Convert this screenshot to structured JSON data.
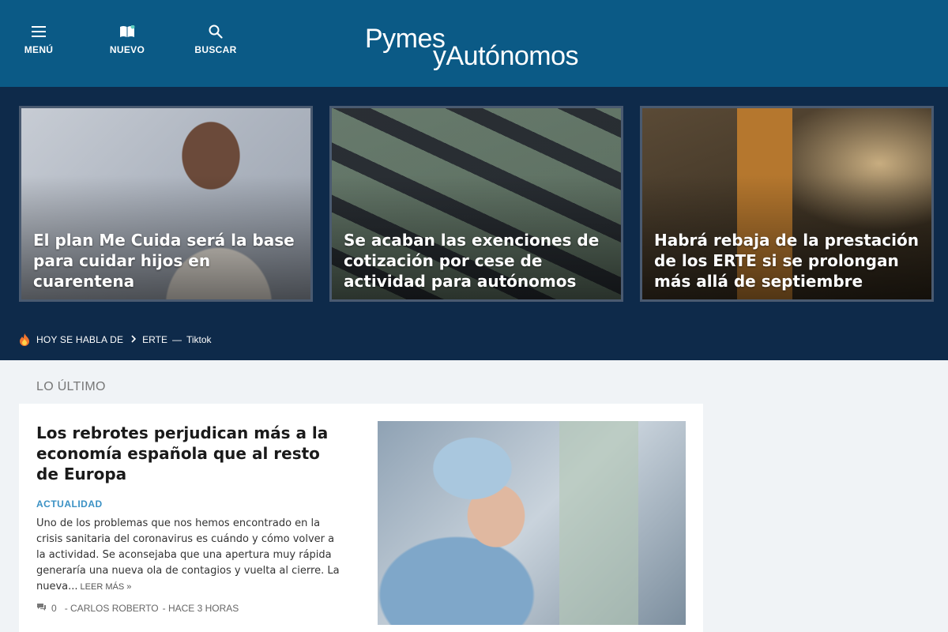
{
  "header": {
    "nav": {
      "menu_label": "MENÚ",
      "nuevo_label": "NUEVO",
      "buscar_label": "BUSCAR"
    },
    "logo": {
      "line1": "Pymes",
      "line2": "yAutónomos"
    },
    "colors": {
      "header_bg": "#0b5a86",
      "hero_bg": "#0e2a4a",
      "accent": "#3a91c4"
    }
  },
  "hero": {
    "cards": [
      {
        "title": "El plan Me Cuida será la base para cuidar hijos en cuarentena"
      },
      {
        "title": "Se acaban las exenciones de cotización por cese de actividad para autónomos"
      },
      {
        "title": "Habrá rebaja de la prestación de los ERTE si se prolongan más allá de septiembre"
      }
    ],
    "trending": {
      "icon": "fire-icon",
      "label": "HOY SE HABLA DE",
      "items": [
        "ERTE",
        "Tiktok"
      ],
      "separator": "—"
    }
  },
  "latest": {
    "section_label": "LO ÚLTIMO",
    "article": {
      "title": "Los rebrotes perjudican más a la economía española que al resto de Europa",
      "category": "ACTUALIDAD",
      "excerpt": "Uno de los problemas que nos hemos encontrado en la crisis sanitaria del coronavirus es cuándo y cómo volver a la actividad. Se aconsejaba que una apertura muy rápida generaría una nueva ola de contagios y vuelta al cierre. La nueva...",
      "read_more": "LEER MÁS »",
      "comments": "0",
      "author": "- CARLOS ROBERTO",
      "time": "- HACE 3 HORAS"
    }
  }
}
